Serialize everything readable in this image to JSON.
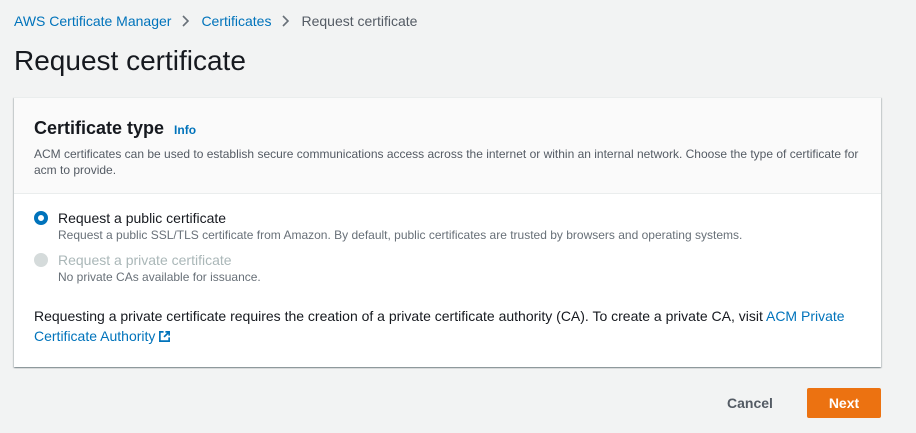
{
  "breadcrumb": {
    "items": [
      {
        "label": "AWS Certificate Manager"
      },
      {
        "label": "Certificates"
      },
      {
        "label": "Request certificate"
      }
    ]
  },
  "page": {
    "title": "Request certificate"
  },
  "panel": {
    "title": "Certificate type",
    "info_label": "Info",
    "description": "ACM certificates can be used to establish secure communications access across the internet or within an internal network. Choose the type of certificate for acm to provide.",
    "options": [
      {
        "label": "Request a public certificate",
        "description": "Request a public SSL/TLS certificate from Amazon. By default, public certificates are trusted by browsers and operating systems.",
        "selected": true,
        "disabled": false
      },
      {
        "label": "Request a private certificate",
        "description": "No private CAs available for issuance.",
        "selected": false,
        "disabled": true
      }
    ],
    "note_text": "Requesting a private certificate requires the creation of a private certificate authority (CA). To create a private CA, visit ",
    "note_link": "ACM Private Certificate Authority"
  },
  "footer": {
    "cancel_label": "Cancel",
    "next_label": "Next"
  },
  "colors": {
    "link": "#0073bb",
    "primary_button": "#ec7211",
    "background": "#f2f3f3"
  }
}
